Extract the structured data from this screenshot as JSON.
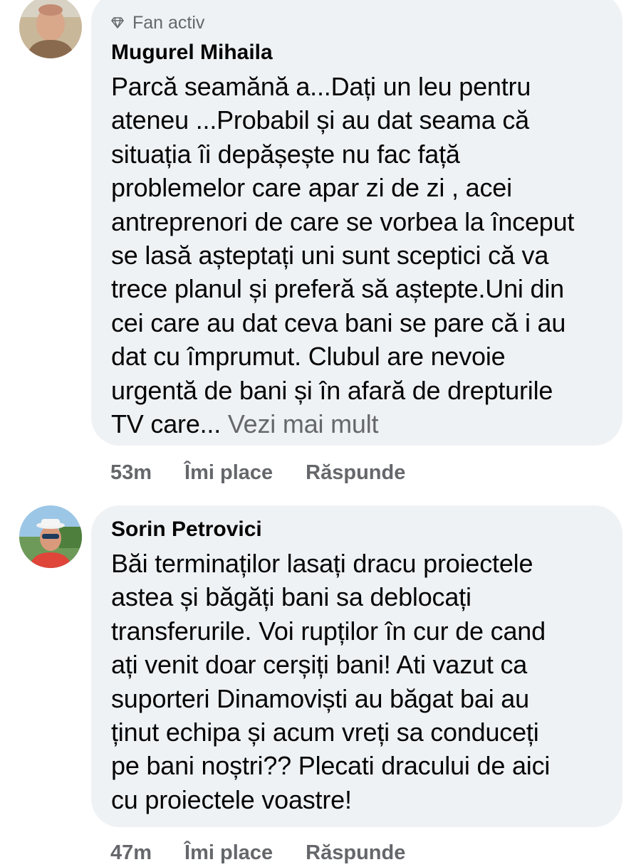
{
  "comments": [
    {
      "badge_icon": "diamond-icon",
      "badge": "Fan activ",
      "author": "Mugurel Mihaila",
      "lines": [
        "Parcă seamănă a...Dați un leu pentru",
        "ateneu ...Probabil și au dat seama că",
        "situația îi depășește nu fac față",
        "problemelor care apar zi de zi , acei",
        "antreprenori de care se vorbea la început",
        "se lasă așteptați uni sunt sceptici că va",
        "trece planul și preferă să aștepte.Uni din",
        "cei care au dat ceva bani se pare că i au",
        "dat cu împrumut. Clubul are nevoie",
        "urgentă de bani și în afară de drepturile"
      ],
      "last_line": "TV care...",
      "see_more": "Vezi mai mult",
      "time": "53m",
      "like": "Îmi place",
      "reply": "Răspunde"
    },
    {
      "author": "Sorin Petrovici",
      "lines": [
        "Băi terminaților lasați dracu proiectele",
        "astea și băgăți bani sa deblocați",
        "transferurile. Voi rupților în cur de cand",
        "ați venit doar cerșiți bani! Ati vazut ca",
        "suporteri Dinamoviști au băgat bai au",
        "ținut echipa și acum vreți sa conduceți",
        "pe bani noștri?? Plecati dracului de aici",
        "cu proiectele voastre!"
      ],
      "time": "47m",
      "like": "Îmi place",
      "reply": "Răspunde"
    }
  ],
  "colors": {
    "bubble": "#eff2f5",
    "text": "#050505",
    "secondary": "#65676b"
  }
}
